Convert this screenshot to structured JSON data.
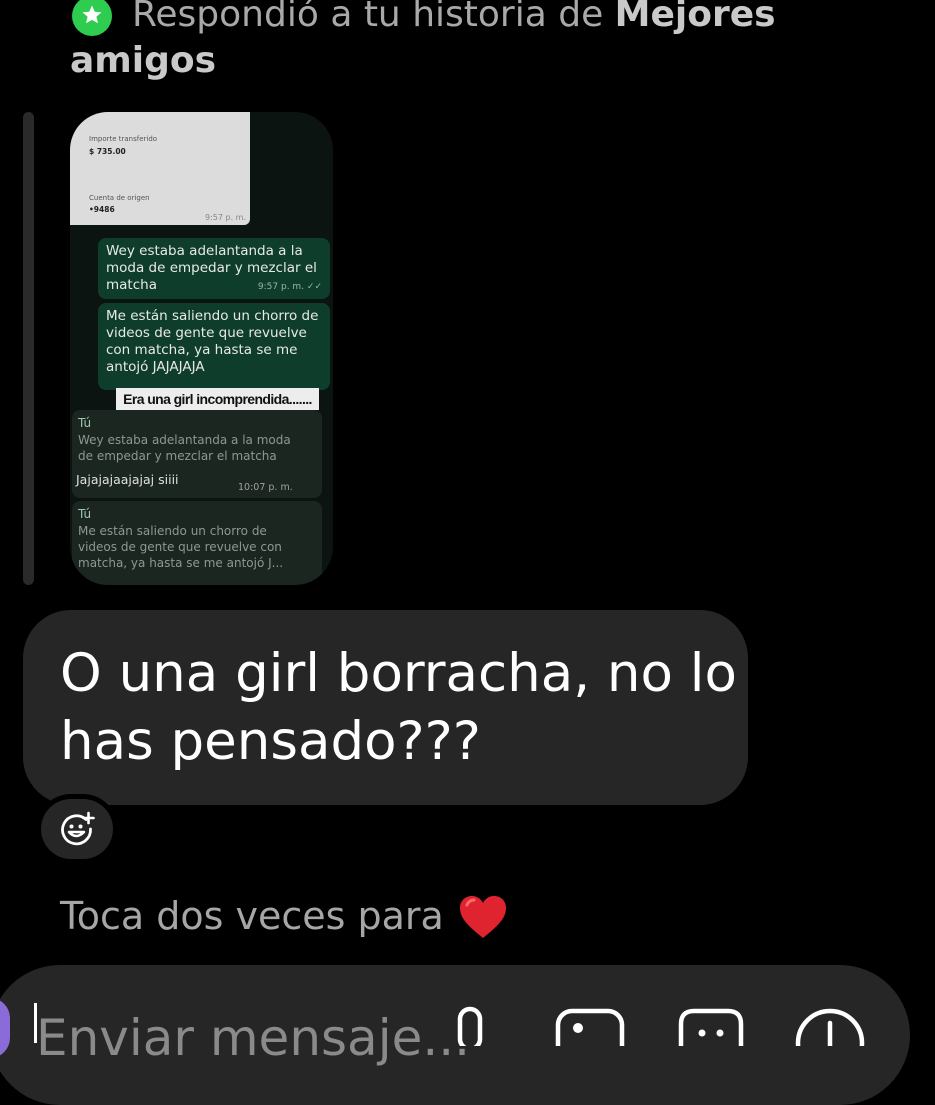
{
  "header": {
    "prefix": "Respondió a tu historia de ",
    "bold": "Mejores amigos",
    "badge_color": "#2ecc4f",
    "badge_icon": "star-icon"
  },
  "story": {
    "card": {
      "label1": "Importe transferido",
      "value1": "$ 735.00",
      "label2": "Cuenta de origen",
      "value2": "•9486",
      "time": "9:57 p. m."
    },
    "outgoing": [
      {
        "text": "Wey estaba adelantanda a la moda de empedar y mezclar el matcha",
        "time": "9:57 p. m. ✓✓"
      },
      {
        "text": "Me están saliendo un chorro de videos de gente que revuelve con matcha, ya hasta se me antojó JAJAJAJA",
        "time": ""
      }
    ],
    "caption": "Era una girl incomprendida.......",
    "quoted_1": {
      "who": "Tú",
      "text": "Wey estaba adelantanda a la moda de empedar y mezclar el matcha",
      "reply": "Jajajajaajajaj siiii",
      "time": "10:07 p. m."
    },
    "quoted_2": {
      "who": "Tú",
      "text": "Me están saliendo un chorro de videos de gente que revuelve con matcha, ya hasta se me antojó J..."
    }
  },
  "message": {
    "text": "O una girl borracha, no lo has pensado???"
  },
  "reaction": {
    "icon": "add-reaction-icon"
  },
  "hint": {
    "text": "Toca dos veces para",
    "emoji": "heart-icon",
    "emoji_color": "#e0242f"
  },
  "composer": {
    "placeholder": "Enviar mensaje...",
    "icons": [
      "microphone-icon",
      "gallery-icon",
      "sticker-icon",
      "add-icon"
    ]
  }
}
